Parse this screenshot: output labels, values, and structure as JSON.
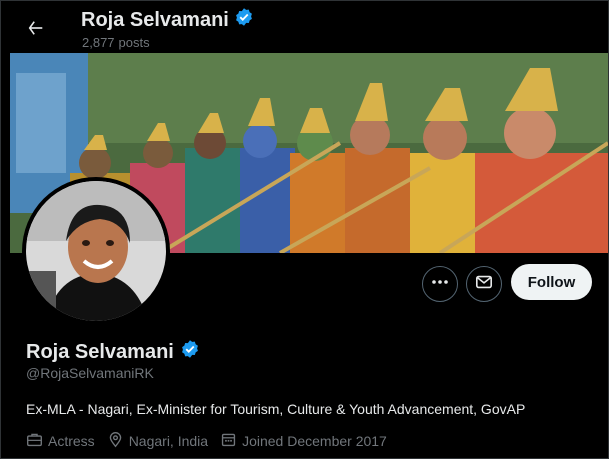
{
  "header": {
    "name": "Roja Selvamani",
    "posts_count": "2,877",
    "posts_label": "posts"
  },
  "profile": {
    "display_name": "Roja Selvamani",
    "handle": "@RojaSelvamaniRK",
    "bio": "Ex-MLA - Nagari, Ex-Minister for Tourism, Culture & Youth Advancement, GovAP",
    "occupation": "Actress",
    "location": "Nagari, India",
    "joined": "Joined December 2017"
  },
  "actions": {
    "follow_label": "Follow"
  },
  "icons": {
    "back": "arrow-left-icon",
    "verified": "verified-badge-icon",
    "more": "more-dots-icon",
    "message": "envelope-icon",
    "occupation": "briefcase-icon",
    "location": "location-pin-icon",
    "joined": "calendar-icon"
  },
  "colors": {
    "background": "#000000",
    "verified": "#1d9bf0",
    "muted": "#71767b",
    "follow_bg": "#eff3f4"
  }
}
